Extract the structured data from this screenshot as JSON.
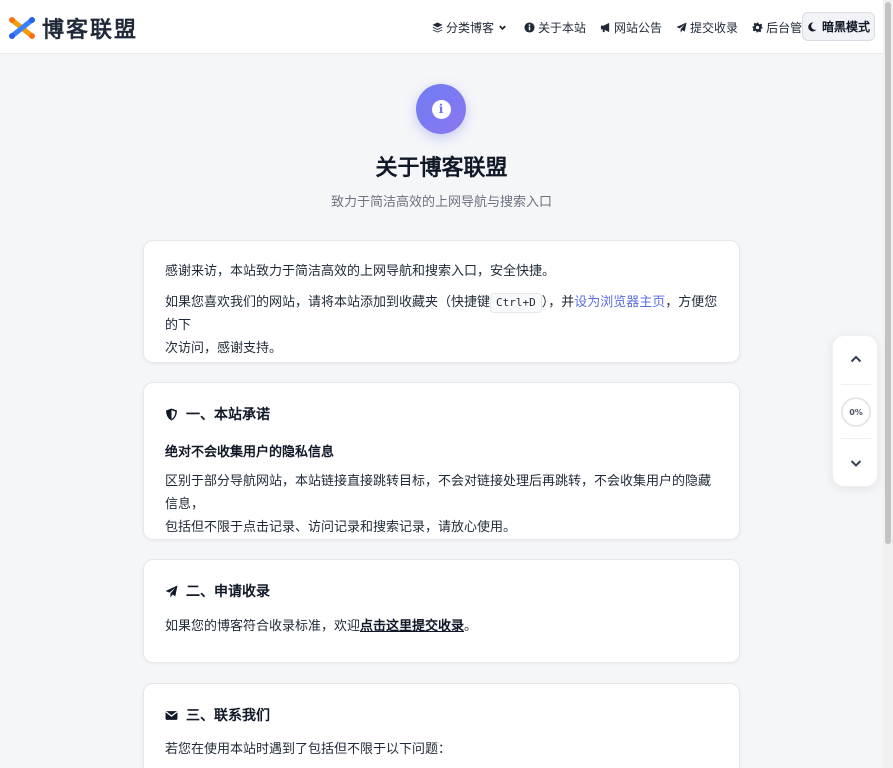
{
  "header": {
    "logo_text": "博客联盟",
    "nav": [
      {
        "label": "分类博客",
        "icon": "layers-icon"
      },
      {
        "label": "关于本站",
        "icon": "info-icon"
      },
      {
        "label": "网站公告",
        "icon": "bullhorn-icon"
      },
      {
        "label": "提交收录",
        "icon": "paper-plane-icon"
      },
      {
        "label": "后台管理",
        "icon": "gear-icon"
      }
    ],
    "dark_mode_label": "暗黑模式"
  },
  "hero": {
    "title": "关于博客联盟",
    "subtitle": "致力于简洁高效的上网导航与搜索入口"
  },
  "intro": {
    "line1": "感谢来访，本站致力于简洁高效的上网导航和搜索入口，安全快捷。",
    "line2_a": "如果您喜欢我们的网站，请将本站添加到收藏夹（快捷键",
    "shortcut": "Ctrl+D",
    "line2_b": "），并",
    "homepage_link": "设为浏览器主页",
    "line2_c": "，方便您的下",
    "line3": "次访问，感谢支持。"
  },
  "section1": {
    "title": "一、本站承诺",
    "subtitle": "绝对不会收集用户的隐私信息",
    "line1": "区别于部分导航网站，本站链接直接跳转目标，不会对链接处理后再跳转，不会收集用户的隐藏信息，",
    "line2": "包括但不限于点击记录、访问记录和搜索记录，请放心使用。"
  },
  "section2": {
    "title": "二、申请收录",
    "text_a": "如果您的博客符合收录标准，欢迎",
    "link": "点击这里提交收录",
    "text_b": "。"
  },
  "section3": {
    "title": "三、联系我们",
    "line1": "若您在使用本站时遇到了包括但不限于以下问题："
  },
  "scroll_widget": {
    "progress": "0%"
  },
  "colors": {
    "accent": "#6f7cf4",
    "link": "#5b6ee1",
    "background": "#f5f6f8"
  }
}
